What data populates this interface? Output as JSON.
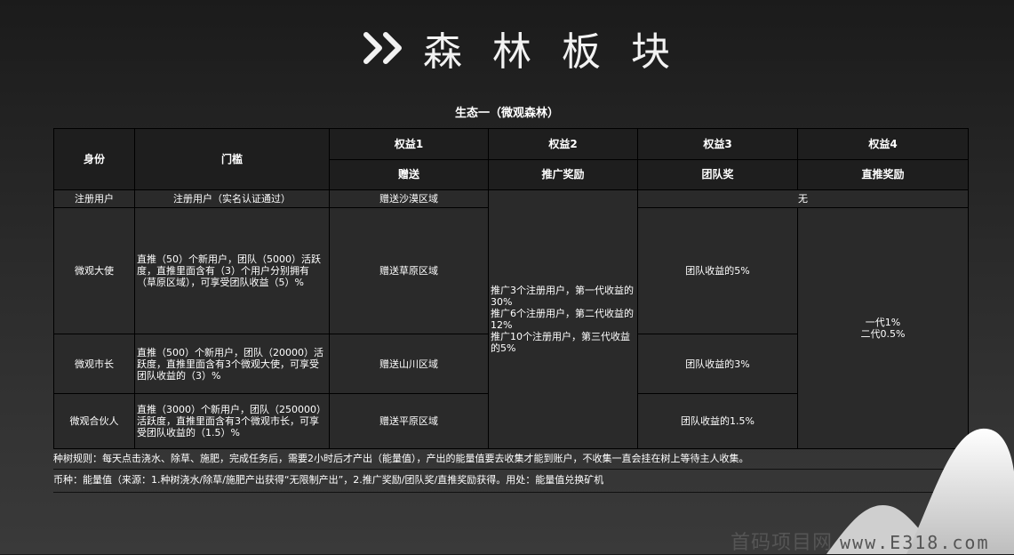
{
  "header": {
    "title": "森林板块"
  },
  "subtitle": "生态一（微观森林）",
  "table": {
    "head": {
      "identity": "身份",
      "threshold": "门槛",
      "benefit1": "权益1",
      "benefit2": "权益2",
      "benefit3": "权益3",
      "benefit4": "权益4",
      "benefit1_sub": "赠送",
      "benefit2_sub": "推广奖励",
      "benefit3_sub": "团队奖",
      "benefit4_sub": "直推奖励"
    },
    "rows": [
      {
        "identity": "注册用户",
        "threshold": "注册用户（实名认证通过）",
        "gift": "赠送沙漠区域",
        "none": "无"
      },
      {
        "identity": "微观大使",
        "threshold": "直推（50）个新用户，团队（5000）活跃度，直推里面含有（3）个用户分别拥有（草原区域），可享受团队收益（5）%",
        "gift": "赠送草原区域",
        "team": "团队收益的5%"
      },
      {
        "identity": "微观市长",
        "threshold": "直推（500）个新用户，团队（20000）活跃度，直推里面含有3个微观大使，可享受团队收益的（3）%",
        "gift": "赠送山川区域",
        "team": "团队收益的3%"
      },
      {
        "identity": "微观合伙人",
        "threshold": "直推（3000）个新用户，团队（250000）活跃度，直推里面含有3个微观市长，可享受团队收益的（1.5）%",
        "gift": "赠送平原区域",
        "team": "团队收益的1.5%"
      }
    ],
    "promo": [
      "推广3个注册用户，第一代收益的30%",
      "推广6个注册用户，第二代收益的12%",
      "推广10个注册用户，第三代收益的5%"
    ],
    "direct": [
      "一代1%",
      "二代0.5%"
    ]
  },
  "rules": {
    "planting": "种树规则：每天点击浇水、除草、施肥，完成任务后，需要2小时后才产出（能量值），产出的能量值要去收集才能到账户，不收集一直会挂在树上等待主人收集。",
    "currency": "币种：能量值（来源：1.种树浇水/除草/施肥产出获得“无限制产出”，2.推广奖励/团队奖/直推奖励获得。用处：能量值兑换矿机"
  },
  "watermark": {
    "cn": "首码项目网",
    "en": "www.E318.com"
  },
  "icons": {
    "header_icon": "double-chevron-right-icon"
  },
  "colors": {
    "background": "#2a2a2a",
    "text": "#ffffff",
    "border": "#000000"
  }
}
